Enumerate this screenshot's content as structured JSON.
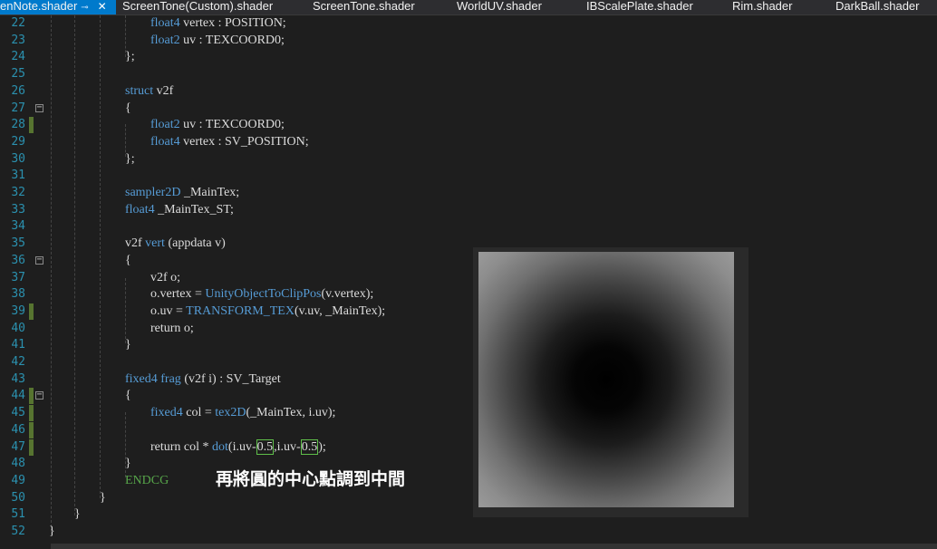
{
  "tabs": [
    {
      "label": "enNote.shader",
      "active": true
    },
    {
      "label": "ScreenTone(Custom).shader"
    },
    {
      "label": "ScreenTone.shader"
    },
    {
      "label": "WorldUV.shader"
    },
    {
      "label": "IBScalePlate.shader"
    },
    {
      "label": "Rim.shader"
    },
    {
      "label": "DarkBall.shader"
    }
  ],
  "lines": [
    {
      "n": "22",
      "code": "float4 vertex : POSITION;"
    },
    {
      "n": "23",
      "code": "float2 uv : TEXCOORD0;"
    },
    {
      "n": "24",
      "code": "};"
    },
    {
      "n": "25",
      "code": ""
    },
    {
      "n": "26",
      "code": "struct v2f"
    },
    {
      "n": "27",
      "code": "{"
    },
    {
      "n": "28",
      "code": "float2 uv : TEXCOORD0;"
    },
    {
      "n": "29",
      "code": "float4 vertex : SV_POSITION;"
    },
    {
      "n": "30",
      "code": "};"
    },
    {
      "n": "31",
      "code": ""
    },
    {
      "n": "32",
      "code": "sampler2D _MainTex;"
    },
    {
      "n": "33",
      "code": "float4 _MainTex_ST;"
    },
    {
      "n": "34",
      "code": ""
    },
    {
      "n": "35",
      "code": "v2f vert (appdata v)"
    },
    {
      "n": "36",
      "code": "{"
    },
    {
      "n": "37",
      "code": "v2f o;"
    },
    {
      "n": "38",
      "code": "o.vertex = UnityObjectToClipPos(v.vertex);"
    },
    {
      "n": "39",
      "code": "o.uv = TRANSFORM_TEX(v.uv, _MainTex);"
    },
    {
      "n": "40",
      "code": "return o;"
    },
    {
      "n": "41",
      "code": "}"
    },
    {
      "n": "42",
      "code": ""
    },
    {
      "n": "43",
      "code": "fixed4 frag (v2f i) : SV_Target"
    },
    {
      "n": "44",
      "code": "{"
    },
    {
      "n": "45",
      "code": "fixed4 col = tex2D(_MainTex, i.uv);"
    },
    {
      "n": "46",
      "code": ""
    },
    {
      "n": "47",
      "code": "return col * dot(i.uv-0.5,i.uv-0.5);"
    },
    {
      "n": "48",
      "code": "}"
    },
    {
      "n": "49",
      "code": "ENDCG"
    },
    {
      "n": "50",
      "code": "}"
    },
    {
      "n": "51",
      "code": "}"
    },
    {
      "n": "52",
      "code": "}"
    }
  ],
  "overlay_caption": "再將圓的中心點調到中間",
  "preview": {
    "icon": "radial-gradient-image"
  }
}
